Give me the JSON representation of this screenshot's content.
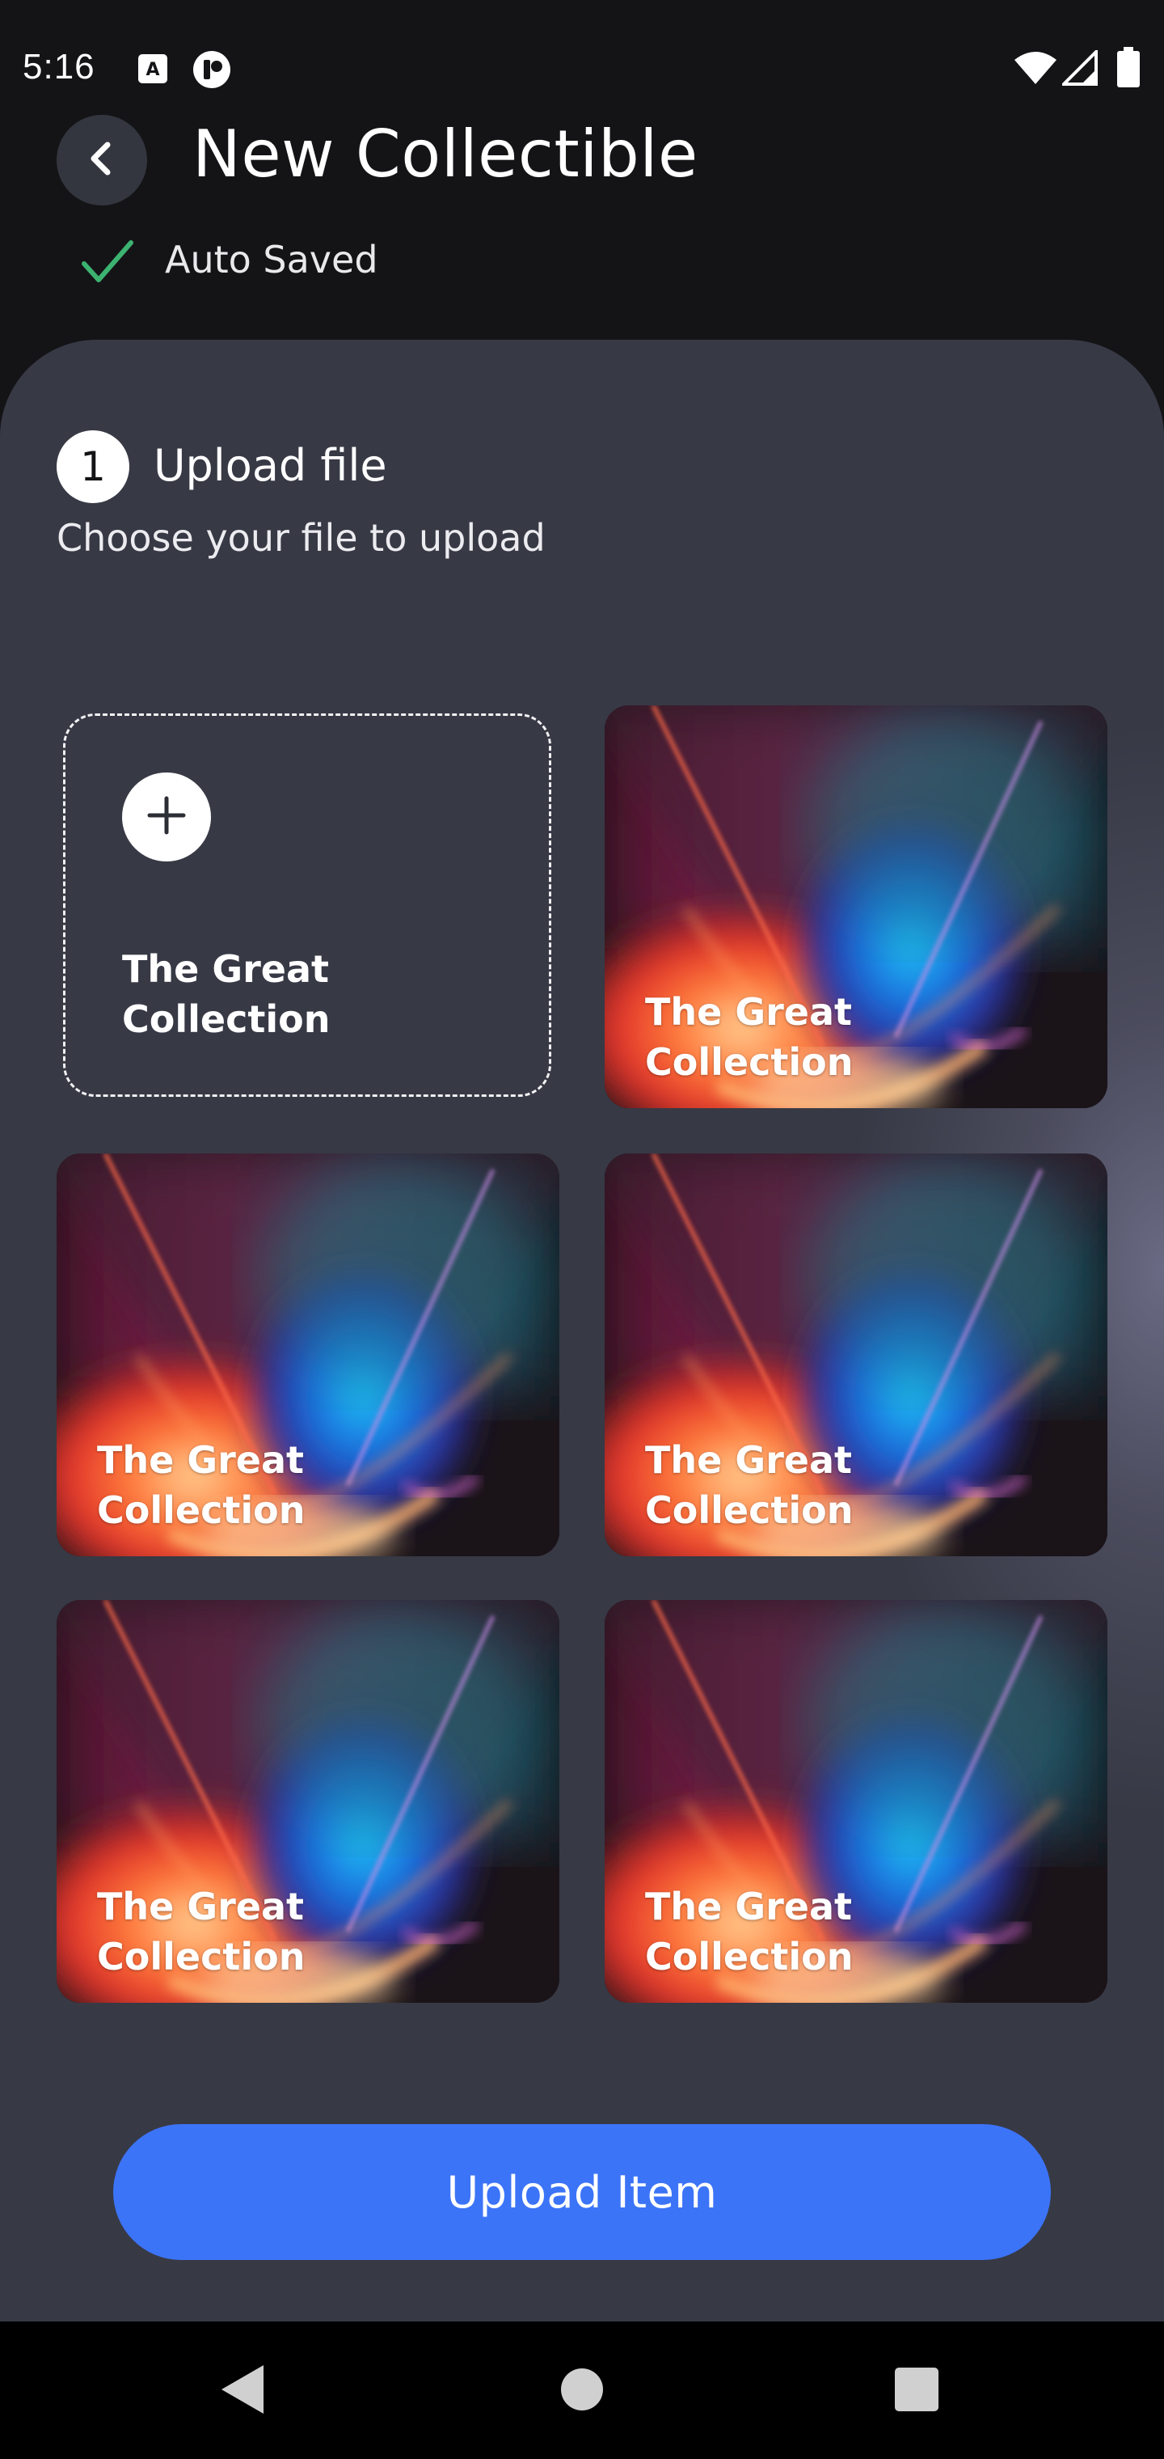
{
  "status_bar": {
    "time": "5:16",
    "icons": [
      "keyboard-icon",
      "app-notification-icon",
      "wifi-icon",
      "signal-icon",
      "battery-icon"
    ]
  },
  "header": {
    "title": "New Collectible",
    "back_icon": "chevron-left-icon",
    "autosave_label": "Auto Saved",
    "autosave_icon": "check-icon"
  },
  "step": {
    "number": "1",
    "title": "Upload file",
    "subtitle": "Choose your file to upload"
  },
  "add_tile": {
    "icon": "plus-icon",
    "label": "The Great Collection"
  },
  "gallery": [
    {
      "label": "The Great Collection"
    },
    {
      "label": "The Great Collection"
    },
    {
      "label": "The Great Collection"
    },
    {
      "label": "The Great Collection"
    },
    {
      "label": "The Great Collection"
    }
  ],
  "upload_button": {
    "label": "Upload Item"
  },
  "nav_bar": {
    "icons": [
      "nav-back-icon",
      "nav-home-icon",
      "nav-recents-icon"
    ]
  },
  "colors": {
    "background": "#141417",
    "card": "#363843",
    "accent": "#3c74f8",
    "autosave_check": "#3cb371"
  }
}
